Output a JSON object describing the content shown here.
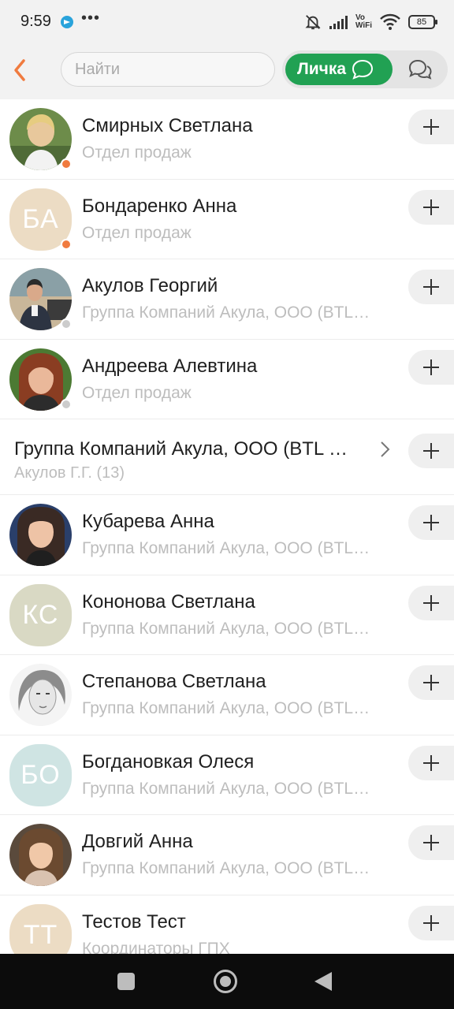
{
  "status_bar": {
    "time": "9:59",
    "more": "•••",
    "battery": "85",
    "icons": [
      "telegram-icon",
      "bell-off-icon",
      "signal-icon",
      "vowifi-icon",
      "wifi-icon",
      "battery-icon"
    ]
  },
  "header": {
    "search_placeholder": "Найти",
    "tab_active_label": "Личка",
    "accent_color": "#21a153",
    "back_color": "#f07b3f"
  },
  "contacts": [
    {
      "name": "Смирных Светлана",
      "subtitle": "Отдел продаж",
      "status": "online",
      "avatar": "photo"
    },
    {
      "name": "Бондаренко Анна",
      "subtitle": "Отдел продаж",
      "status": "online",
      "avatar": "initials",
      "initials": "БА",
      "avatar_color": "#ecdcc4"
    },
    {
      "name": "Акулов Георгий",
      "subtitle": "Группа Компаний Акула, ООО (BTL…",
      "status": "offline",
      "avatar": "photo"
    },
    {
      "name": "Андреева Алевтина",
      "subtitle": "Отдел продаж",
      "status": "offline",
      "avatar": "photo"
    }
  ],
  "group": {
    "name": "Группа Компаний Акула, ООО (BTL …",
    "subtitle": "Акулов Г.Г. (13)"
  },
  "contacts_2": [
    {
      "name": "Кубарева Анна",
      "subtitle": "Группа Компаний Акула, ООО (BTL…",
      "avatar": "photo"
    },
    {
      "name": "Кононова Светлана",
      "subtitle": "Группа Компаний Акула, ООО (BTL…",
      "avatar": "initials",
      "initials": "КС",
      "avatar_color": "#d9d9c4"
    },
    {
      "name": "Степанова Светлана",
      "subtitle": "Группа Компаний Акула, ООО (BTL…",
      "avatar": "photo"
    },
    {
      "name": "Богдановкая Олеся",
      "subtitle": "Группа Компаний Акула, ООО (BTL…",
      "avatar": "initials",
      "initials": "БО",
      "avatar_color": "#cfe4e3"
    },
    {
      "name": "Довгий Анна",
      "subtitle": "Группа Компаний Акула, ООО (BTL…",
      "avatar": "photo"
    },
    {
      "name": "Тестов Тест",
      "subtitle": "Координаторы ГПХ",
      "avatar": "initials",
      "initials": "ТТ",
      "avatar_color": "#ecdcc4"
    }
  ],
  "status_colors": {
    "online": "#f07b3f",
    "offline": "#cccccc"
  }
}
